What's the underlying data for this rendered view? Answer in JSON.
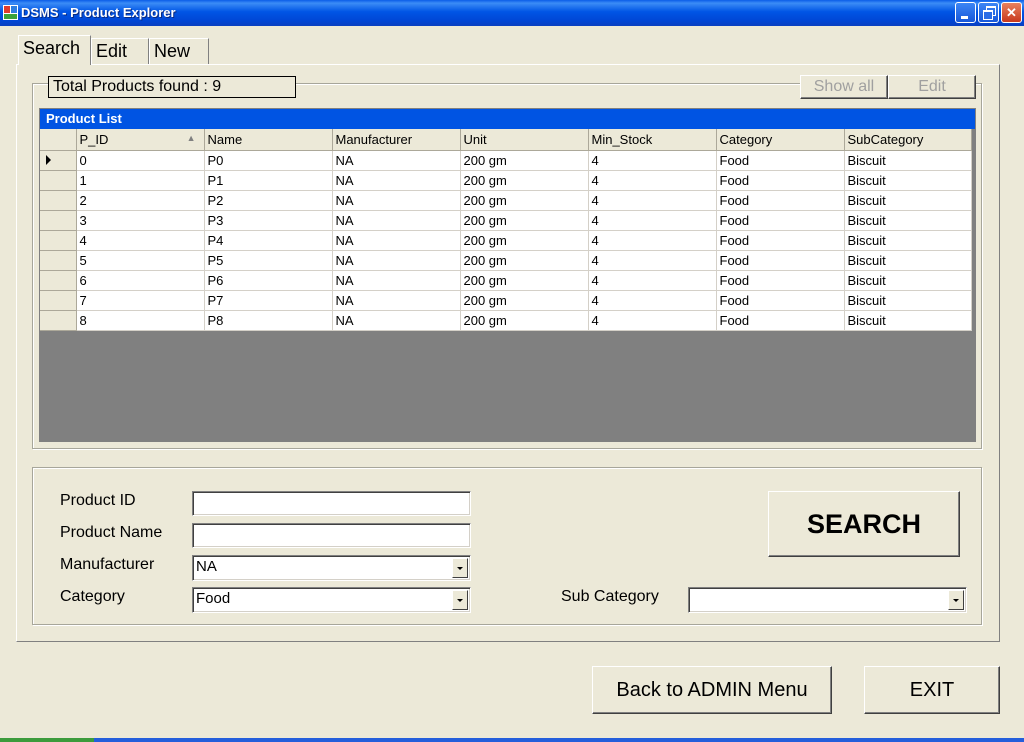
{
  "window": {
    "title": "DSMS - Product Explorer"
  },
  "tabs": [
    {
      "label": "Search",
      "active": true
    },
    {
      "label": "Edit",
      "active": false
    },
    {
      "label": "New",
      "active": false
    }
  ],
  "results": {
    "total_text": "Total Products found : 9",
    "show_all_label": "Show all",
    "edit_label": "Edit"
  },
  "grid": {
    "caption": "Product List",
    "columns": [
      "P_ID",
      "Name",
      "Manufacturer",
      "Unit",
      "Min_Stock",
      "Category",
      "SubCategory"
    ],
    "rows": [
      [
        "0",
        "P0",
        "NA",
        "200 gm",
        "4",
        "Food",
        "Biscuit"
      ],
      [
        "1",
        "P1",
        "NA",
        "200 gm",
        "4",
        "Food",
        "Biscuit"
      ],
      [
        "2",
        "P2",
        "NA",
        "200 gm",
        "4",
        "Food",
        "Biscuit"
      ],
      [
        "3",
        "P3",
        "NA",
        "200 gm",
        "4",
        "Food",
        "Biscuit"
      ],
      [
        "4",
        "P4",
        "NA",
        "200 gm",
        "4",
        "Food",
        "Biscuit"
      ],
      [
        "5",
        "P5",
        "NA",
        "200 gm",
        "4",
        "Food",
        "Biscuit"
      ],
      [
        "6",
        "P6",
        "NA",
        "200 gm",
        "4",
        "Food",
        "Biscuit"
      ],
      [
        "7",
        "P7",
        "NA",
        "200 gm",
        "4",
        "Food",
        "Biscuit"
      ],
      [
        "8",
        "P8",
        "NA",
        "200 gm",
        "4",
        "Food",
        "Biscuit"
      ]
    ]
  },
  "form": {
    "product_id_label": "Product ID",
    "product_id_value": "",
    "product_name_label": "Product Name",
    "product_name_value": "",
    "manufacturer_label": "Manufacturer",
    "manufacturer_value": "NA",
    "category_label": "Category",
    "category_value": "Food",
    "subcategory_label": "Sub Category",
    "subcategory_value": "",
    "search_label": "SEARCH"
  },
  "footer": {
    "back_label": "Back to ADMIN Menu",
    "exit_label": "EXIT"
  },
  "colors": {
    "titlebar": "#0054e3",
    "face": "#ece9d8",
    "grid_caption": "#0054e3",
    "grid_empty": "#808080"
  }
}
